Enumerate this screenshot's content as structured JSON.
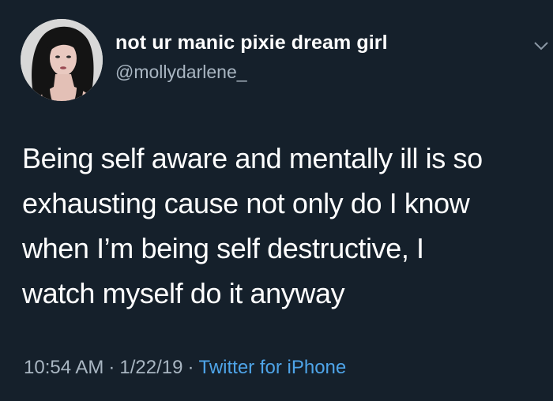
{
  "tweet": {
    "author": {
      "display_name": "not ur manic pixie dream girl",
      "handle": "@mollydarlene_",
      "avatar_icon": "profile-photo"
    },
    "menu_icon": "chevron-down-icon",
    "text_lines": [
      "Being self aware and mentally ill is so",
      "exhausting cause not only do I know",
      "when I’m being self destructive, I",
      "watch myself do it anyway"
    ],
    "meta": {
      "time": "10:54 AM",
      "date": "1/22/19",
      "separator": "·",
      "source": "Twitter for iPhone"
    }
  },
  "colors": {
    "background": "#15202b",
    "text": "#ffffff",
    "secondary_text": "#a9b6c2",
    "link": "#4ea4e8"
  }
}
